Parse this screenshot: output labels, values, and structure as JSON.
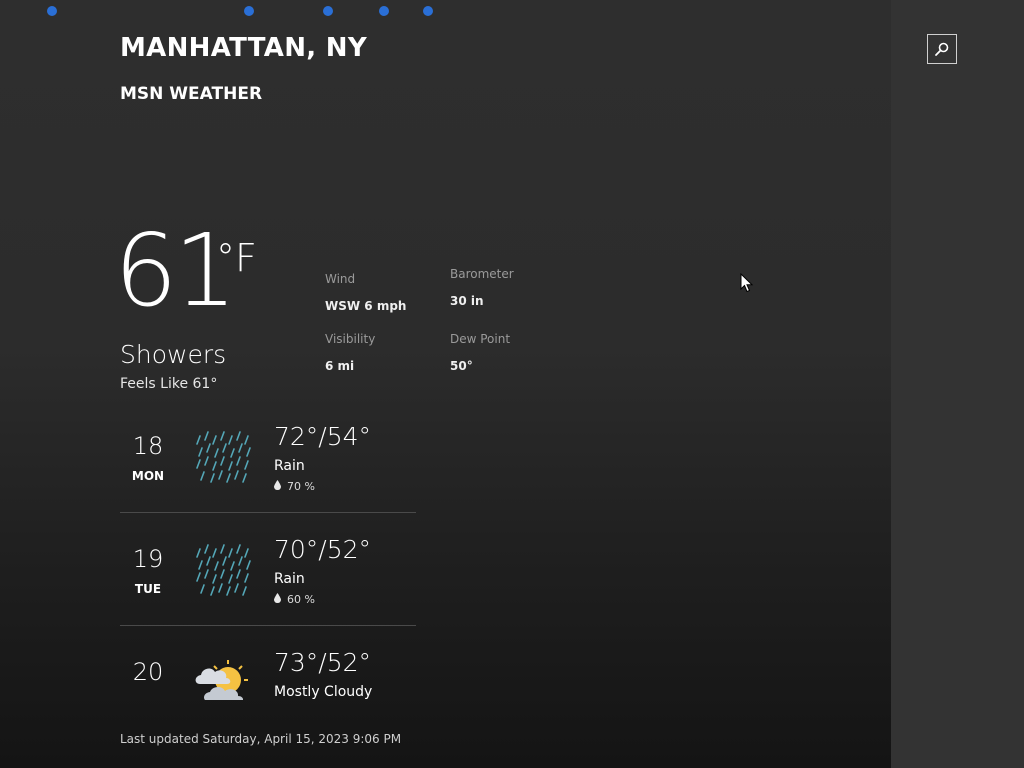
{
  "header": {
    "city": "MANHATTAN, NY",
    "provider": "MSN WEATHER"
  },
  "current": {
    "temperature": "61",
    "unit": "°F",
    "condition": "Showers",
    "feels_like": "Feels Like 61°"
  },
  "details": [
    {
      "label": "Wind",
      "value": "WSW 6 mph"
    },
    {
      "label": "Barometer",
      "value": "30 in"
    },
    {
      "label": "Visibility",
      "value": "6 mi"
    },
    {
      "label": "Dew Point",
      "value": "50°"
    }
  ],
  "forecast": [
    {
      "day": "18",
      "dow": "MON",
      "temps": "72°/54°",
      "condition": "Rain",
      "precip": "70 %",
      "icon": "rain-icon"
    },
    {
      "day": "19",
      "dow": "TUE",
      "temps": "70°/52°",
      "condition": "Rain",
      "precip": "60 %",
      "icon": "rain-icon"
    },
    {
      "day": "20",
      "dow": "",
      "temps": "73°/52°",
      "condition": "Mostly Cloudy",
      "precip": "",
      "icon": "partly-cloudy-icon"
    }
  ],
  "footer": {
    "last_updated": "Last updated Saturday, April 15, 2023 9:06 PM"
  },
  "colors": {
    "loading_dot": "#2a6fd6",
    "rain_drop": "#5ab6c8",
    "sun": "#f5c242"
  }
}
